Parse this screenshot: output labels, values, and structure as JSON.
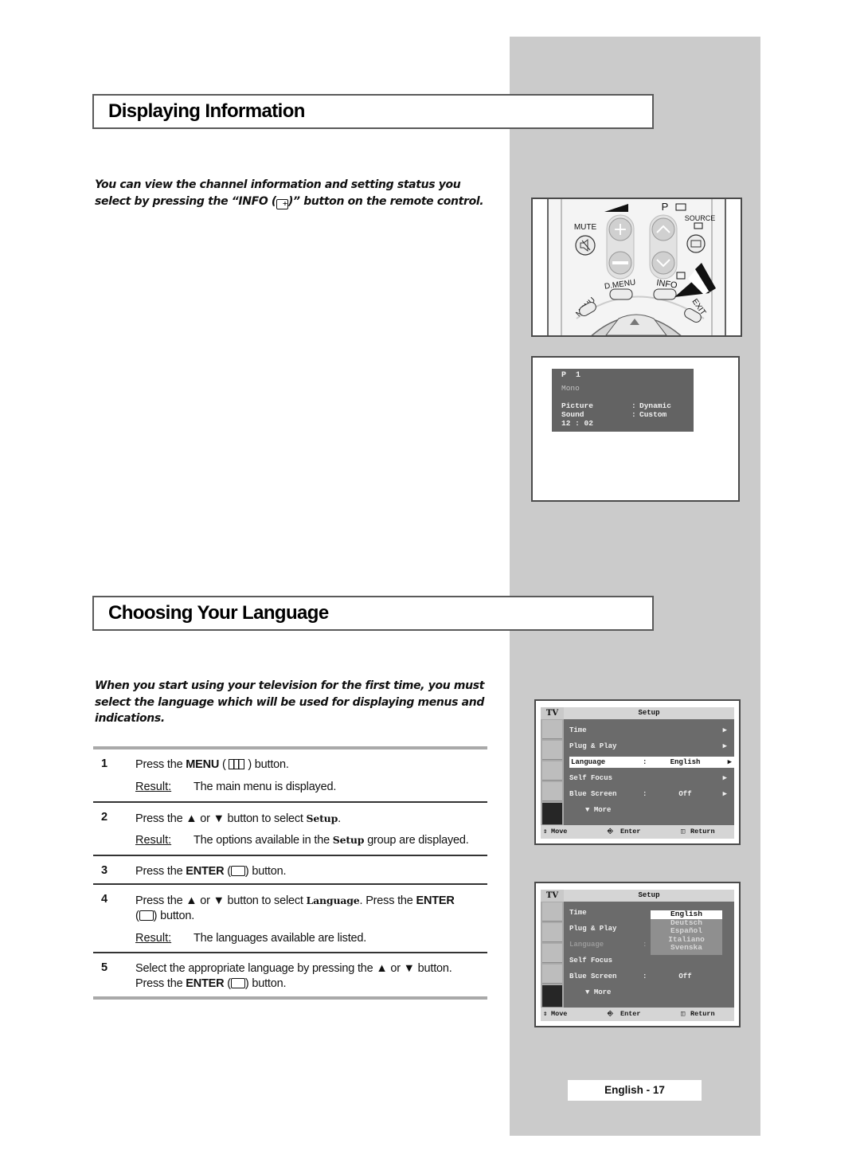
{
  "section_info": {
    "title": "Displaying Information",
    "intro_before": "You can view the channel information and setting status you select by pressing the “INFO (",
    "intro_after": ")” button on the remote control."
  },
  "remote": {
    "labels": {
      "mute": "MUTE",
      "p": "P",
      "source": "SOURCE",
      "dmenu": "D.MENU",
      "info": "INFO",
      "menu": "MENU",
      "exit": "EXIT"
    }
  },
  "osd_info": {
    "channel": "P  1",
    "audio": "Mono",
    "picture_label": "Picture",
    "picture_value": "Dynamic",
    "sound_label": "Sound",
    "sound_value": "Custom",
    "separator": ":",
    "time": "12 : 02"
  },
  "section_lang": {
    "title": "Choosing Your Language",
    "intro": "When you start using your television for the first time, you must select the language which will be used for displaying menus and indications."
  },
  "steps": [
    {
      "num": "1",
      "pre": "Press the ",
      "bold": "MENU",
      "post": ") button.",
      "result_label": "Result:",
      "result": "The main menu is displayed."
    },
    {
      "num": "2",
      "pre": "Press the ▲ or ▼ button to select ",
      "code": "Setup",
      "post": ".",
      "result_label": "Result:",
      "result_pre": "The options available in the ",
      "result_code": "Setup",
      "result_post": " group are displayed."
    },
    {
      "num": "3",
      "pre": "Press the ",
      "bold": "ENTER",
      "post": ") button."
    },
    {
      "num": "4",
      "pre": "Press the ▲ or ▼ button to select ",
      "code": "Language",
      "mid": ". Press the ",
      "bold": "ENTER",
      "post": ") button.",
      "result_label": "Result:",
      "result": "The languages available are listed."
    },
    {
      "num": "5",
      "line1": "Select the appropriate language by pressing the ▲ or ▼ button.",
      "pre": "Press the ",
      "bold": "ENTER",
      "post": ") button."
    }
  ],
  "tv_menu": {
    "tab": "TV",
    "header": "Setup",
    "items": [
      {
        "label": "Time",
        "value": ""
      },
      {
        "label": "Plug & Play",
        "value": ""
      },
      {
        "label": "Language",
        "value": "English"
      },
      {
        "label": "Self Focus",
        "value": ""
      },
      {
        "label": "Blue Screen",
        "value": "Off"
      }
    ],
    "separator": ":",
    "more": "More",
    "footer": {
      "move": "Move",
      "enter": "Enter",
      "return": "Return"
    },
    "sidebar_icons": [
      "input-icon",
      "picture-icon",
      "sound-icon",
      "channel-icon",
      "setup-icon"
    ]
  },
  "tv_menu_2": {
    "languages": [
      "English",
      "Deutsch",
      "Español",
      "Italiano",
      "Svenska"
    ],
    "selected": "English"
  },
  "page_label": "English - 17"
}
